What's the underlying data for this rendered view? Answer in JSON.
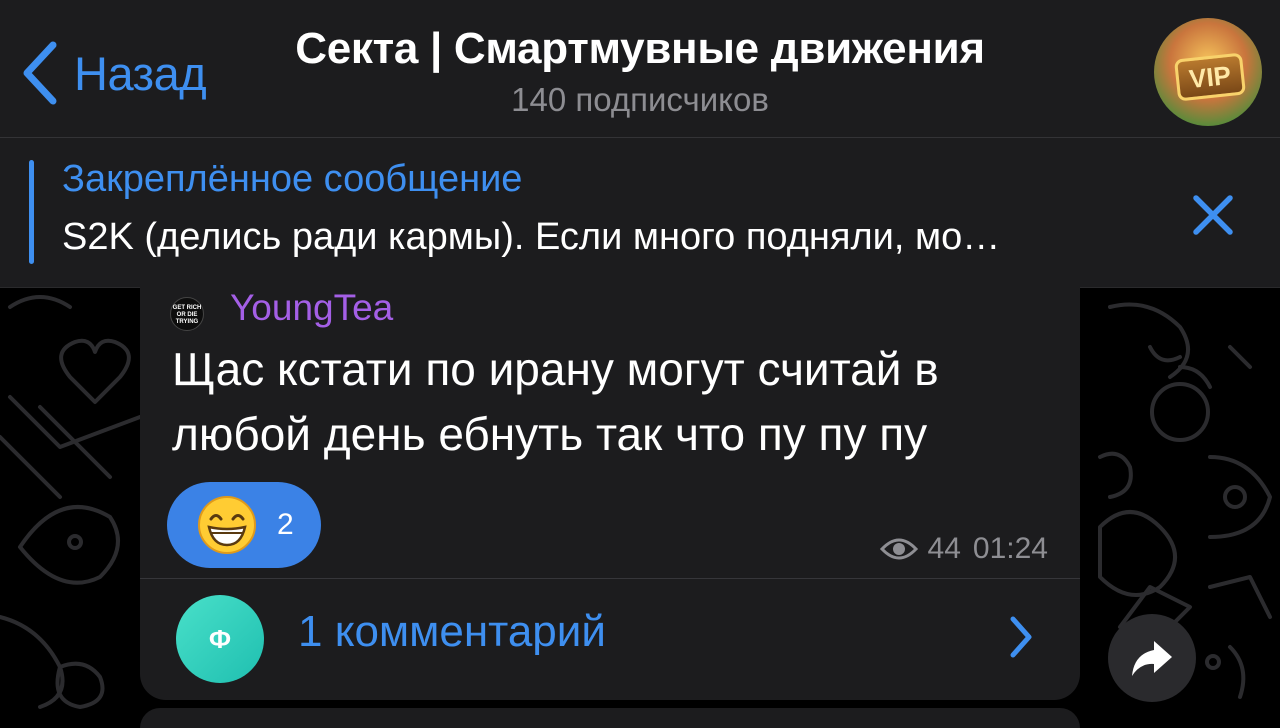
{
  "header": {
    "back_label": "Назад",
    "title": "Секта | Смартмувные движения",
    "subtitle": "140 подписчиков",
    "avatar_badge": "VIP"
  },
  "pinned": {
    "title": "Закреплённое сообщение",
    "text": "S2K (делись ради кармы). Если много подняли, мо…"
  },
  "message": {
    "author_avatar_text": "GET RICH OR DIE TRYING",
    "author": "YoungTea",
    "text": "Щас кстати по ирану могут считай в любой день ебнуть так что пу пу пу",
    "reaction": {
      "emoji": "grinning-face-with-smiling-eyes",
      "count": "2"
    },
    "views": "44",
    "time": "01:24"
  },
  "comments": {
    "avatar_letter": "Ф",
    "label": "1 комментарий"
  },
  "colors": {
    "accent": "#3e8ff0",
    "author": "#a45fe6",
    "bubble": "#1c1c1e",
    "reaction": "#3b82e6"
  }
}
